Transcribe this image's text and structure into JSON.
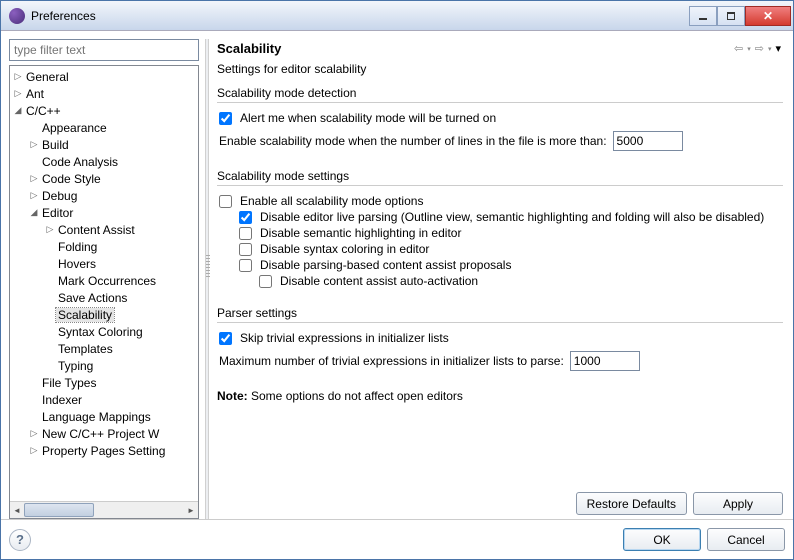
{
  "window": {
    "title": "Preferences"
  },
  "sidebar": {
    "filter_placeholder": "type filter text",
    "items": {
      "general": "General",
      "ant": "Ant",
      "ccpp": "C/C++",
      "appearance": "Appearance",
      "build": "Build",
      "code_analysis": "Code Analysis",
      "code_style": "Code Style",
      "debug": "Debug",
      "editor": "Editor",
      "content_assist": "Content Assist",
      "folding": "Folding",
      "hovers": "Hovers",
      "mark_occurrences": "Mark Occurrences",
      "save_actions": "Save Actions",
      "scalability": "Scalability",
      "syntax_coloring": "Syntax Coloring",
      "templates": "Templates",
      "typing": "Typing",
      "file_types": "File Types",
      "indexer": "Indexer",
      "language_mappings": "Language Mappings",
      "new_project": "New C/C++ Project W",
      "property_pages": "Property Pages Setting"
    }
  },
  "page": {
    "title": "Scalability",
    "subtitle": "Settings for editor scalability",
    "group1": {
      "title": "Scalability mode detection",
      "alert_label": "Alert me when scalability mode will be turned on",
      "alert_checked": true,
      "threshold_label": "Enable scalability mode when the number of lines in the file is more than:",
      "threshold_value": "5000"
    },
    "group2": {
      "title": "Scalability mode settings",
      "enable_all_label": "Enable all scalability mode options",
      "enable_all_checked": false,
      "opt1_label": "Disable editor live parsing (Outline view, semantic highlighting and folding will also be disabled)",
      "opt1_checked": true,
      "opt2_label": "Disable semantic highlighting in editor",
      "opt2_checked": false,
      "opt3_label": "Disable syntax coloring in editor",
      "opt3_checked": false,
      "opt4_label": "Disable parsing-based content assist proposals",
      "opt4_checked": false,
      "opt5_label": "Disable content assist auto-activation",
      "opt5_checked": false
    },
    "group3": {
      "title": "Parser settings",
      "skip_label": "Skip trivial expressions in initializer lists",
      "skip_checked": true,
      "max_label": "Maximum number of trivial expressions in initializer lists to parse:",
      "max_value": "1000"
    },
    "note_prefix": "Note:",
    "note_text": " Some options do not affect open editors"
  },
  "buttons": {
    "restore": "Restore Defaults",
    "apply": "Apply",
    "ok": "OK",
    "cancel": "Cancel"
  }
}
